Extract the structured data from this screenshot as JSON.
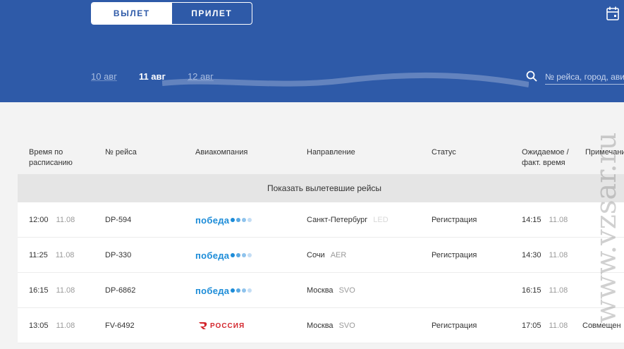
{
  "tabs": {
    "departure": "ВЫЛЕТ",
    "arrival": "ПРИЛЕТ"
  },
  "dates": [
    {
      "label": "10 авг",
      "active": false
    },
    {
      "label": "11 авг",
      "active": true
    },
    {
      "label": "12 авг",
      "active": false
    }
  ],
  "search": {
    "placeholder": "№ рейса, город, авиакомпания"
  },
  "table": {
    "headers": {
      "time": "Время по расписанию",
      "flight": "№ рейса",
      "airline": "Авиакомпания",
      "direction": "Направление",
      "status": "Статус",
      "expected": "Ожидаемое / факт. время",
      "note": "Примечание"
    },
    "show_departed": "Показать вылетевшие рейсы",
    "rows": [
      {
        "time": "12:00",
        "date": "11.08",
        "flight": "DP-594",
        "airline": "победа",
        "city": "Санкт-Петербург",
        "code": "LED",
        "status": "Регистрация",
        "exp_time": "14:15",
        "exp_date": "11.08",
        "note": ""
      },
      {
        "time": "11:25",
        "date": "11.08",
        "flight": "DP-330",
        "airline": "победа",
        "city": "Сочи",
        "code": "AER",
        "status": "Регистрация",
        "exp_time": "14:30",
        "exp_date": "11.08",
        "note": ""
      },
      {
        "time": "16:15",
        "date": "11.08",
        "flight": "DP-6862",
        "airline": "победа",
        "city": "Москва",
        "code": "SVO",
        "status": "",
        "exp_time": "16:15",
        "exp_date": "11.08",
        "note": ""
      },
      {
        "time": "13:05",
        "date": "11.08",
        "flight": "FV-6492",
        "airline": "РОССИЯ",
        "city": "Москва",
        "code": "SVO",
        "status": "Регистрация",
        "exp_time": "17:05",
        "exp_date": "11.08",
        "note": "Совмещен"
      }
    ]
  },
  "watermark": "www.vzsar.ru",
  "colors": {
    "header": "#2e5aa8",
    "pobeda": "#1c8cd8",
    "rossiya": "#d3242b"
  }
}
